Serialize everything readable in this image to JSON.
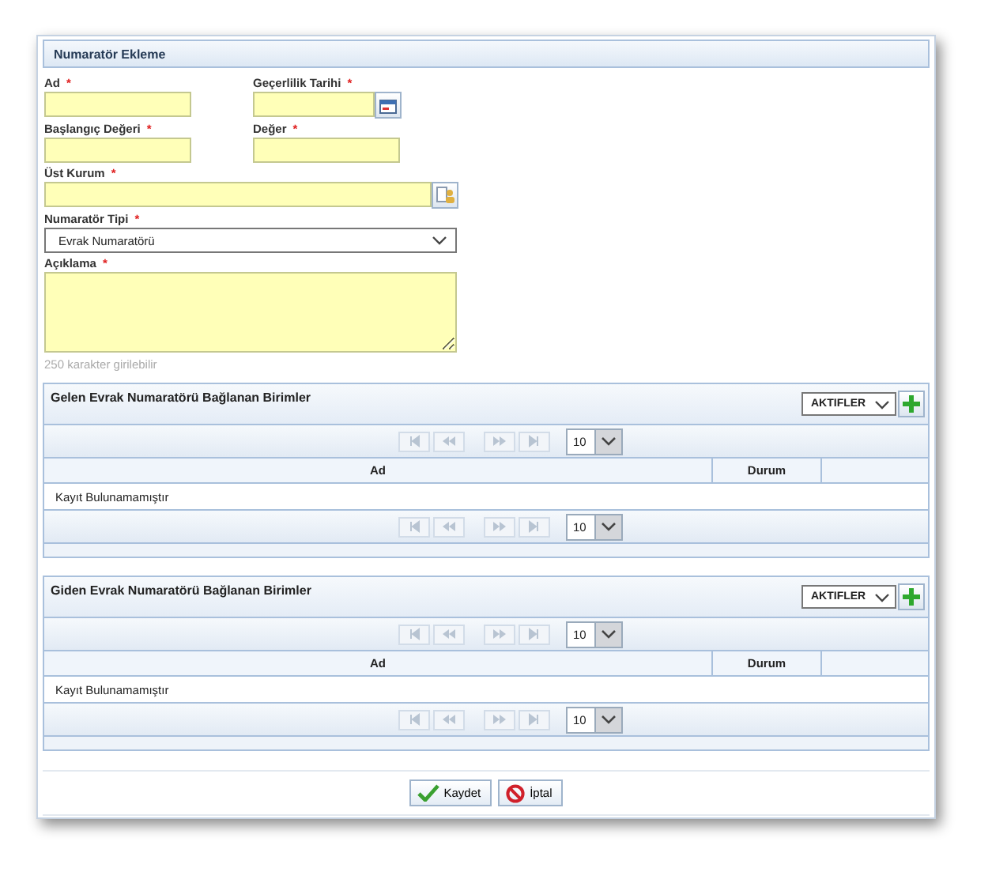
{
  "form": {
    "title": "Numaratör Ekleme",
    "fields": [
      {
        "label": "Ad",
        "kind": "text",
        "required_mark": "*"
      },
      {
        "label": "Geçerlilik Tarihi",
        "kind": "date",
        "required_mark": "*"
      },
      {
        "label": "Başlangıç Değeri",
        "kind": "text",
        "required_mark": "*"
      },
      {
        "label": "Değer",
        "kind": "text",
        "required_mark": "*"
      },
      {
        "label": "Üst Kurum",
        "kind": "lookup",
        "required_mark": "*"
      },
      {
        "label": "Numaratör Tipi",
        "kind": "select",
        "required_mark": "*",
        "value": "Evrak Numaratörü"
      },
      {
        "label": "Açıklama",
        "kind": "textarea",
        "required_mark": "*",
        "hint": "250 karakter girilebilir"
      }
    ]
  },
  "grids": [
    {
      "title": "Gelen Evrak Numaratörü Bağlanan Birimler",
      "filter": "AKTIFLER",
      "columns": [
        "Ad",
        "Durum"
      ],
      "empty_message": "Kayıt Bulunamamıştır",
      "top_page_size": "10",
      "bottom_page_size": "10"
    },
    {
      "title": "Giden Evrak Numaratörü Bağlanan Birimler",
      "filter": "AKTIFLER",
      "columns": [
        "Ad",
        "Durum"
      ],
      "empty_message": "Kayıt Bulunamamıştır",
      "top_page_size": "10",
      "bottom_page_size": "10"
    }
  ],
  "buttons": [
    {
      "label": "Kaydet",
      "kind": "save"
    },
    {
      "label": "İptal",
      "kind": "cancel"
    }
  ]
}
